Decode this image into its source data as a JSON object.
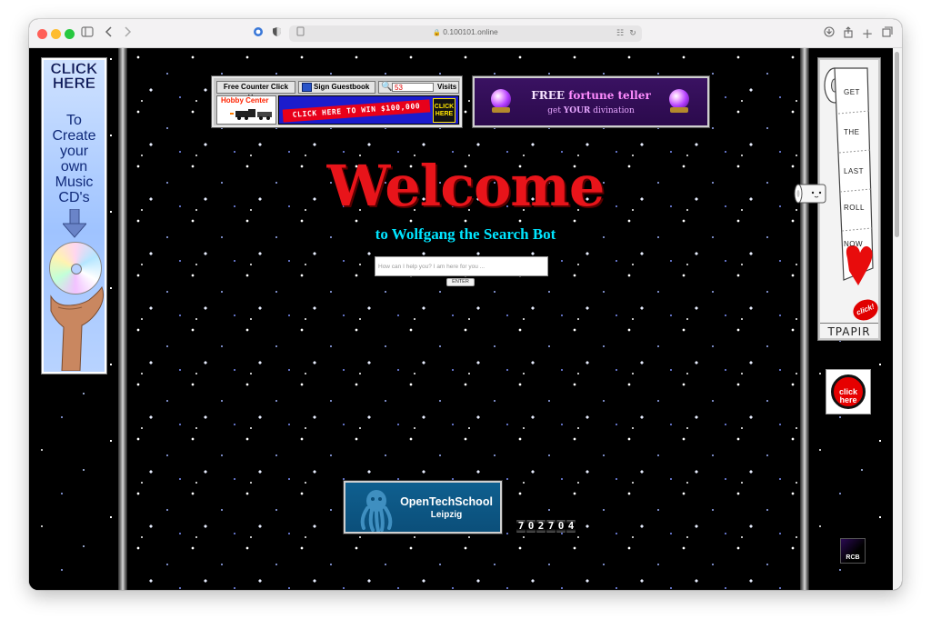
{
  "browser": {
    "url": "0.100101.online",
    "traffic_lights": {
      "close": "#ff5f57",
      "minimize": "#febc2e",
      "zoom": "#28c840"
    },
    "icons": [
      "sidebar-icon",
      "back-icon",
      "forward-icon",
      "privacy-report-icon",
      "shield-icon",
      "page-icon",
      "lock-icon",
      "translate-icon",
      "reload-icon",
      "download-icon",
      "share-icon",
      "new-tab-icon",
      "tab-overview-icon"
    ]
  },
  "left_ad": {
    "headline": "CLICK HERE",
    "line1": "To",
    "line2": "Create",
    "line3": "your",
    "line4": "own",
    "line5": "Music",
    "line6": "CD's",
    "icons": [
      "down-arrow-icon",
      "cd-icon",
      "hand-icon"
    ]
  },
  "counter_banner": {
    "free_counter": "Free Counter Click Here",
    "guestbook": "Sign Guestbook",
    "visit_count": "53",
    "visits_label": "Visits",
    "hobby_center": "Hobby Center",
    "win_text": "CLICK HERE TO WIN $100,000",
    "click_here": "CLICK HERE"
  },
  "fortune": {
    "free": "FREE",
    "title": "fortune teller",
    "subtitle_pre": "get ",
    "subtitle_your": "YOUR",
    "subtitle_post": " divination",
    "icons": [
      "crystal-ball-icon"
    ]
  },
  "main": {
    "welcome": "Welcome",
    "subtitle": "to Wolfgang the Search Bot",
    "search_placeholder": "How can I help you? I am here for you ...",
    "enter_button": "ENTER"
  },
  "ots": {
    "title": "OpenTechSchool",
    "city": "Leipzig"
  },
  "odometer": {
    "value": "702704",
    "digits": [
      "7",
      "0",
      "2",
      "7",
      "0",
      "4"
    ]
  },
  "tp_ad": {
    "words": [
      "GET",
      "THE",
      "LAST",
      "ROLL",
      "NOW"
    ],
    "click": "click!",
    "name": "TPAPIR",
    "icons": [
      "toilet-paper-icon",
      "heart-icon"
    ]
  },
  "click_badge": {
    "text": "click here",
    "ring_text": "ENTER ENTER ENTER"
  },
  "rcb": {
    "label": "RCB"
  },
  "colors": {
    "welcome": "#e8141a",
    "subtitle": "#00e5ff",
    "background": "#000000"
  }
}
